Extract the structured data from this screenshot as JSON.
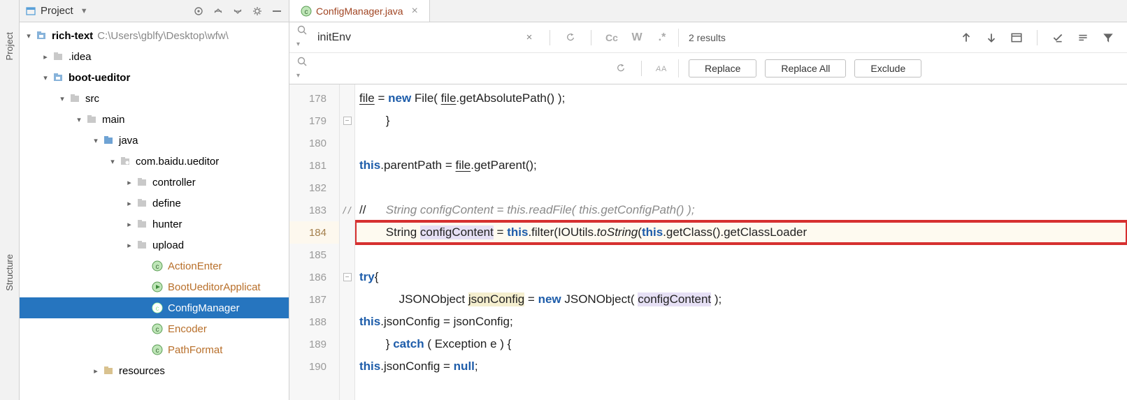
{
  "sideTabs": {
    "project": "Project",
    "structure": "Structure"
  },
  "projectHeader": {
    "title": "Project"
  },
  "tree": {
    "root": {
      "name": "rich-text",
      "path": "C:\\Users\\gblfy\\Desktop\\wfw\\"
    },
    "idea": ".idea",
    "bootUeditor": "boot-ueditor",
    "src": "src",
    "main": "main",
    "java": "java",
    "pkg": "com.baidu.ueditor",
    "controller": "controller",
    "define": "define",
    "hunter": "hunter",
    "upload": "upload",
    "classes": {
      "actionEnter": "ActionEnter",
      "bootUeditorApp": "BootUeditorApplicat",
      "configManager": "ConfigManager",
      "encoder": "Encoder",
      "pathFormat": "PathFormat"
    },
    "resources": "resources"
  },
  "tab": {
    "filename": "ConfigManager.java"
  },
  "search": {
    "findValue": "initEnv",
    "replaceValue": "",
    "resultsText": "2 results",
    "matchCase": "Cc",
    "words": "W",
    "regex": ".*",
    "replaceBtn": "Replace",
    "replaceAllBtn": "Replace All",
    "excludeBtn": "Exclude"
  },
  "code": {
    "lineStart": 178,
    "lines": [
      {
        "n": 178,
        "html": "            <span class='id-u'>file</span> = <span class='kw'>new</span> File( <span class='id-u'>file</span>.getAbsolutePath() );"
      },
      {
        "n": 179,
        "html": "        }"
      },
      {
        "n": 180,
        "html": ""
      },
      {
        "n": 181,
        "html": "        <span class='kw'>this</span>.parentPath = <span class='id-u'>file</span>.getParent();"
      },
      {
        "n": 182,
        "html": ""
      },
      {
        "n": 183,
        "html": "//      <span class='comment'>String configContent = this.readFile( this.getConfigPath() );</span>"
      },
      {
        "n": 184,
        "hl": true,
        "html": "        String <span class='hl-var'>configContent</span> = <span class='kw'>this</span>.filter(IOUtils.<span class='ital'>toString</span>(<span class='kw'>this</span>.getClass().getClassLoader"
      },
      {
        "n": 185,
        "html": ""
      },
      {
        "n": 186,
        "html": "        <span class='kw'>try</span>{"
      },
      {
        "n": 187,
        "html": "            JSONObject <span class='hl-var2'>jsonConfig</span> = <span class='kw'>new</span> JSONObject( <span class='hl-var'>configContent</span> );"
      },
      {
        "n": 188,
        "html": "            <span class='kw'>this</span>.jsonConfig = jsonConfig;"
      },
      {
        "n": 189,
        "html": "        } <span class='kw'>catch</span> ( Exception e ) {"
      },
      {
        "n": 190,
        "html": "            <span class='kw'>this</span>.jsonConfig = <span class='kw'>null</span>;"
      }
    ]
  }
}
